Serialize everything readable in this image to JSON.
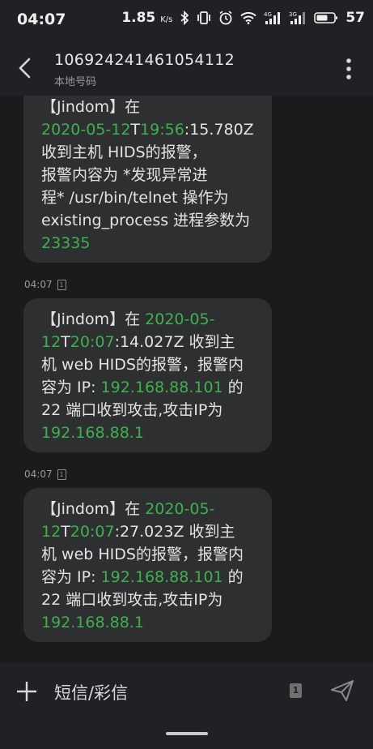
{
  "status_bar": {
    "time": "04:07",
    "speed_value": "1.85",
    "speed_unit": "K/s",
    "battery": "57",
    "icons": [
      "bluetooth-icon",
      "vibrate-icon",
      "alarm-icon",
      "wifi-icon",
      "signal-4g-icon",
      "signal-3g-icon",
      "battery-icon"
    ]
  },
  "header": {
    "title": "106924241461054112",
    "subtitle": "本地号码",
    "icons": [
      "back-arrow-icon",
      "more-vert-icon"
    ]
  },
  "messages": [
    {
      "lines": [
        [
          {
            "t": "【Jindom】在",
            "c": ""
          }
        ],
        [
          {
            "t": "2020-05-12",
            "c": "g"
          },
          {
            "t": "T",
            "c": ""
          },
          {
            "t": "19:56",
            "c": "g"
          },
          {
            "t": ":15.780Z",
            "c": ""
          }
        ],
        [
          {
            "t": "收到主机  HIDS的报警，",
            "c": ""
          }
        ],
        [
          {
            "t": "报警内容为 *发现异常进",
            "c": ""
          }
        ],
        [
          {
            "t": "程* /usr/bin/telnet 操作为",
            "c": ""
          }
        ],
        [
          {
            "t": "existing_process 进程参数为",
            "c": ""
          }
        ],
        [
          {
            "t": "23335",
            "c": "g"
          }
        ]
      ]
    },
    {
      "time": "04:07",
      "sim": "1",
      "lines": [
        [
          {
            "t": "【Jindom】在 ",
            "c": ""
          },
          {
            "t": "2020-05-",
            "c": "g"
          }
        ],
        [
          {
            "t": "12",
            "c": "g"
          },
          {
            "t": "T",
            "c": ""
          },
          {
            "t": "20:07",
            "c": "g"
          },
          {
            "t": ":14.027Z 收到主",
            "c": ""
          }
        ],
        [
          {
            "t": "机 web HIDS的报警，报警内",
            "c": ""
          }
        ],
        [
          {
            "t": "容为 IP: ",
            "c": ""
          },
          {
            "t": "192.168.88.101",
            "c": "g"
          },
          {
            "t": " 的",
            "c": ""
          }
        ],
        [
          {
            "t": "22 端口收到攻击,攻击IP为",
            "c": ""
          }
        ],
        [
          {
            "t": "192.168.88.1",
            "c": "g"
          }
        ]
      ]
    },
    {
      "time": "04:07",
      "sim": "1",
      "lines": [
        [
          {
            "t": "【Jindom】在 ",
            "c": ""
          },
          {
            "t": "2020-05-",
            "c": "g"
          }
        ],
        [
          {
            "t": "12",
            "c": "g"
          },
          {
            "t": "T",
            "c": ""
          },
          {
            "t": "20:07",
            "c": "g"
          },
          {
            "t": ":27.023Z 收到主",
            "c": ""
          }
        ],
        [
          {
            "t": "机 web HIDS的报警，报警内",
            "c": ""
          }
        ],
        [
          {
            "t": "容为 IP: ",
            "c": ""
          },
          {
            "t": "192.168.88.101",
            "c": "g"
          },
          {
            "t": " 的",
            "c": ""
          }
        ],
        [
          {
            "t": "22 端口收到攻击,攻击IP为",
            "c": ""
          }
        ],
        [
          {
            "t": "192.168.88.1",
            "c": "g"
          }
        ]
      ]
    }
  ],
  "composer": {
    "placeholder": "短信/彩信",
    "sim_label": "1",
    "icons": [
      "add-icon",
      "sim-card-icon",
      "send-icon"
    ]
  },
  "colors": {
    "background": "#1b1b1d",
    "bubble": "#2e2f31",
    "highlight": "#3fb04f"
  }
}
